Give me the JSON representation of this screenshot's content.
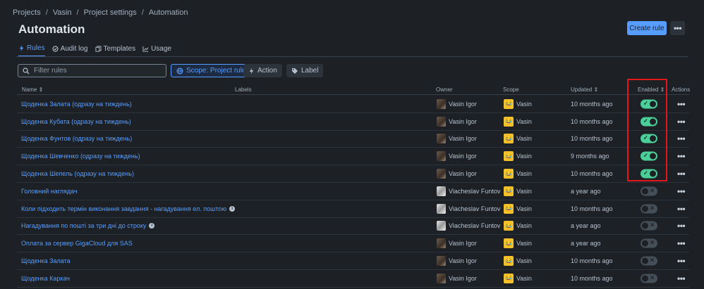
{
  "breadcrumb": [
    "Projects",
    "Vasin",
    "Project settings",
    "Automation"
  ],
  "page_title": "Automation",
  "header": {
    "create_label": "Create rule",
    "more_label": "•••"
  },
  "tabs": [
    {
      "label": "Rules",
      "icon": "bolt-icon",
      "active": true
    },
    {
      "label": "Audit log",
      "icon": "check-circle-icon",
      "active": false
    },
    {
      "label": "Templates",
      "icon": "copy-icon",
      "active": false
    },
    {
      "label": "Usage",
      "icon": "chart-icon",
      "active": false
    }
  ],
  "filters": {
    "search_placeholder": "Filter rules",
    "scope_label": "Scope: Project rules",
    "action_label": "Action",
    "label_label": "Label"
  },
  "table": {
    "headers": {
      "name": "Name",
      "labels": "Labels",
      "owner": "Owner",
      "scope": "Scope",
      "updated": "Updated",
      "enabled": "Enabled",
      "actions": "Actions"
    },
    "rows": [
      {
        "name": "Щоденка Залата (одразу на тиждень)",
        "info": false,
        "owner": "Vasin Igor",
        "owner_avatar": "vi",
        "scope": "Vasin",
        "updated": "10 months ago",
        "enabled": true
      },
      {
        "name": "Щоденка Кубата (одразу на тиждень)",
        "info": false,
        "owner": "Vasin Igor",
        "owner_avatar": "vi",
        "scope": "Vasin",
        "updated": "10 months ago",
        "enabled": true
      },
      {
        "name": "Щоденка Фунтов (одразу на тиждень)",
        "info": false,
        "owner": "Vasin Igor",
        "owner_avatar": "vi",
        "scope": "Vasin",
        "updated": "10 months ago",
        "enabled": true
      },
      {
        "name": "Щоденка Шевченко (одразу на тиждень)",
        "info": false,
        "owner": "Vasin Igor",
        "owner_avatar": "vi",
        "scope": "Vasin",
        "updated": "9 months ago",
        "enabled": true
      },
      {
        "name": "Щоденка Шепель (одразу на тиждень)",
        "info": false,
        "owner": "Vasin Igor",
        "owner_avatar": "vi",
        "scope": "Vasin",
        "updated": "10 months ago",
        "enabled": true
      },
      {
        "name": "Головний наглядач",
        "info": false,
        "owner": "Viacheslav Funtov",
        "owner_avatar": "vf",
        "scope": "Vasin",
        "updated": "a year ago",
        "enabled": false
      },
      {
        "name": "Коли підходить термін виконання завдання - нагадування ел. поштою",
        "info": true,
        "owner": "Viacheslav Funtov",
        "owner_avatar": "vf",
        "scope": "Vasin",
        "updated": "10 months ago",
        "enabled": false
      },
      {
        "name": "Нагадування по пошті за три дні до строку",
        "info": true,
        "owner": "Viacheslav Funtov",
        "owner_avatar": "vf",
        "scope": "Vasin",
        "updated": "a year ago",
        "enabled": false
      },
      {
        "name": "Оплата за сервер GigaCloud для SAS",
        "info": false,
        "owner": "Vasin Igor",
        "owner_avatar": "vi",
        "scope": "Vasin",
        "updated": "a year ago",
        "enabled": false
      },
      {
        "name": "Щоденка Залата",
        "info": false,
        "owner": "Vasin Igor",
        "owner_avatar": "vi",
        "scope": "Vasin",
        "updated": "10 months ago",
        "enabled": false
      },
      {
        "name": "Щоденка Каркач",
        "info": false,
        "owner": "Vasin Igor",
        "owner_avatar": "vi",
        "scope": "Vasin",
        "updated": "10 months ago",
        "enabled": false
      }
    ]
  },
  "colors": {
    "accent": "#579dff",
    "enabled_on": "#4bce97",
    "enabled_off": "#454f59",
    "highlight": "#e2161b"
  }
}
